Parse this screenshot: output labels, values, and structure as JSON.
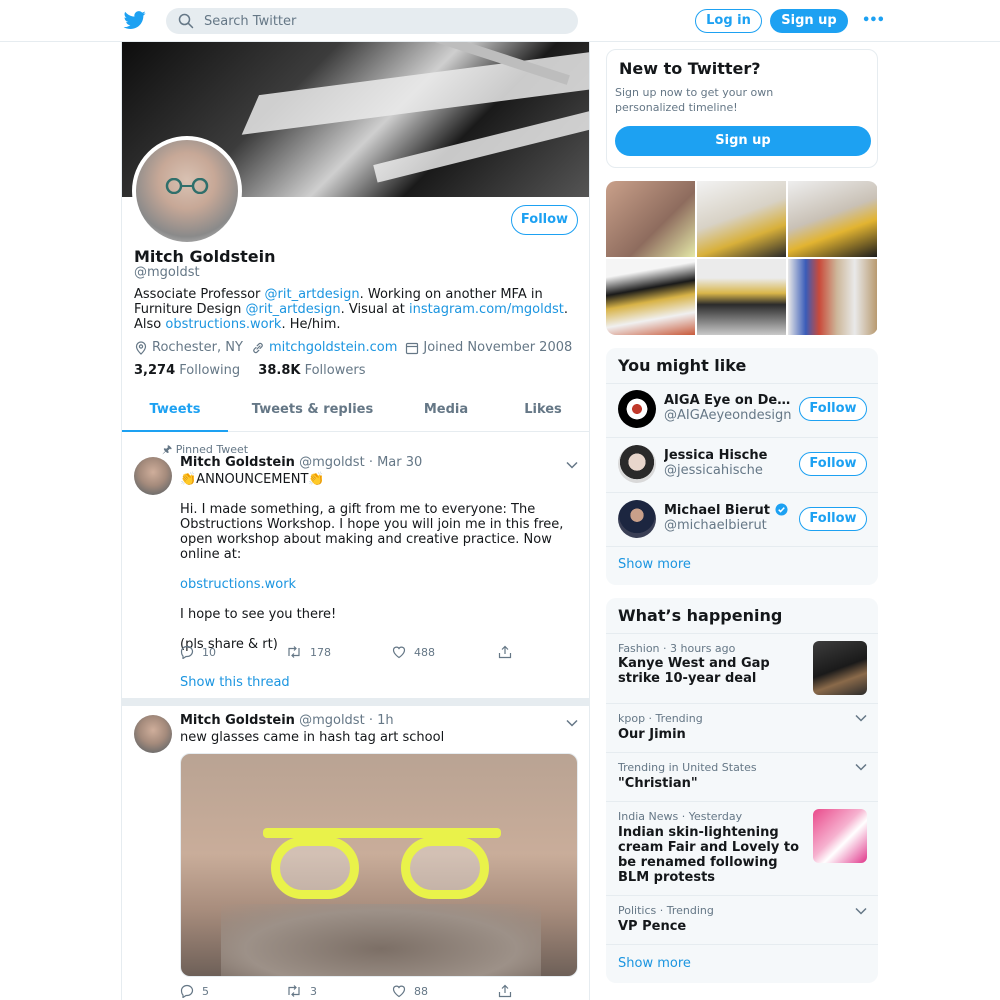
{
  "topbar": {
    "search_placeholder": "Search Twitter",
    "login_label": "Log in",
    "signup_label": "Sign up",
    "more_label": "•••"
  },
  "profile": {
    "follow_label": "Follow",
    "name": "Mitch Goldstein",
    "handle": "@mgoldst",
    "bio": {
      "t1": "Associate Professor ",
      "l1": "@rit_artdesign",
      "t2": ". Working on another MFA in Furniture Design ",
      "l2": "@rit_artdesign",
      "t3": ". Visual at ",
      "l3": "instagram.com/mgoldst",
      "t4": ". Also ",
      "l4": "obstructions.work",
      "t5": ". He/him."
    },
    "location": "Rochester, NY",
    "website": "mitchgoldstein.com",
    "joined": "Joined November 2008",
    "following_count": "3,274",
    "following_label": "Following",
    "followers_count": "38.8K",
    "followers_label": "Followers"
  },
  "tabs": [
    "Tweets",
    "Tweets & replies",
    "Media",
    "Likes"
  ],
  "tweets": [
    {
      "pinned_label": "Pinned Tweet",
      "name": "Mitch Goldstein",
      "handle_time": "@mgoldst · Mar 30",
      "line1": "👏ANNOUNCEMENT👏",
      "para1": "Hi. I made something, a gift from me to everyone: The Obstructions Workshop. I hope you will join me in this free, open workshop about making and creative practice. Now online at:",
      "link": "obstructions.work",
      "para2": "I hope to see you there!",
      "para3": "(pls share & rt)",
      "replies": "10",
      "retweets": "178",
      "likes": "488",
      "show_thread": "Show this thread"
    },
    {
      "name": "Mitch Goldstein",
      "handle_time": "@mgoldst · 1h",
      "text": "new glasses came in hash tag art school",
      "replies": "5",
      "retweets": "3",
      "likes": "88"
    }
  ],
  "new_to_twitter": {
    "title": "New to Twitter?",
    "text": "Sign up now to get your own personalized timeline!",
    "signup_label": "Sign up"
  },
  "you_might_like": {
    "title": "You might like",
    "accounts": [
      {
        "name": "AIGA Eye on Desi...",
        "handle": "@AIGAeyeondesign",
        "follow": "Follow"
      },
      {
        "name": "Jessica Hische",
        "handle": "@jessicahische",
        "follow": "Follow"
      },
      {
        "name": "Michael Bierut",
        "handle": "@michaelbierut",
        "follow": "Follow"
      }
    ],
    "show_more": "Show more"
  },
  "whats_happening": {
    "title": "What’s happening",
    "items": [
      {
        "meta": "Fashion · 3 hours ago",
        "title": "Kanye West and Gap strike 10-year deal"
      },
      {
        "meta": "kpop · Trending",
        "title": "Our Jimin"
      },
      {
        "meta": "Trending in United States",
        "title": "\"Christian\""
      },
      {
        "meta": "India News · Yesterday",
        "title": "Indian skin-lightening cream Fair and Lovely to be renamed following BLM protests"
      },
      {
        "meta": "Politics · Trending",
        "title": "VP Pence"
      }
    ],
    "show_more": "Show more"
  },
  "colors": {
    "accent": "#1da1f2",
    "link": "#1b95e0",
    "secondary_text": "#657786",
    "border": "#e6ecf0",
    "card_bg": "#f5f8fa"
  }
}
